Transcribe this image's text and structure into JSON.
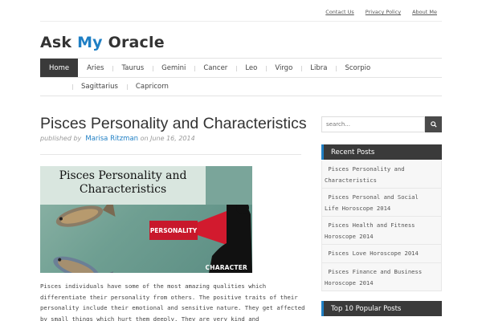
{
  "top_links": [
    "Contact Us",
    "Privacy Policy",
    "About Me"
  ],
  "logo": {
    "part1": "Ask ",
    "accent": "My",
    "part2": " Oracle"
  },
  "nav": {
    "row1": [
      "Home",
      "Aries",
      "Taurus",
      "Gemini",
      "Cancer",
      "Leo",
      "Virgo",
      "Libra",
      "Scorpio"
    ],
    "row2": [
      "Sagittarius",
      "Capricorn"
    ],
    "active": "Home"
  },
  "post": {
    "title": "Pisces Personality and Characteristics",
    "meta_prefix": "published by",
    "author": "Marisa Ritzman",
    "meta_on": "on",
    "date": "June 16, 2014",
    "image": {
      "heading_line1": "Pisces Personality and",
      "heading_line2": "Characteristics",
      "personality_label": "PERSONALITY",
      "character_label": "CHARACTER"
    },
    "body": "Pisces individuals have some of the most amazing qualities which differentiate their personality from others. The positive traits of their personality include their emotional and sensitive nature. They get affected by small things which hurt them deeply. They are very kind and"
  },
  "sidebar": {
    "search_placeholder": "search...",
    "recent_title": "Recent Posts",
    "recent_posts": [
      {
        "line1": " Pisces Personality and",
        "line2": "Characteristics"
      },
      {
        "line1": " Pisces Personal and Social",
        "line2": "Life Horoscope 2014"
      },
      {
        "line1": " Pisces Health and Fitness",
        "line2": "Horoscope 2014"
      },
      {
        "line1": " Pisces Love Horoscope 2014",
        "line2": ""
      },
      {
        "line1": " Pisces Finance and Business",
        "line2": "Horoscope 2014"
      }
    ],
    "popular_title": "Top 10 Popular Posts"
  },
  "colors": {
    "accent": "#1f7fc4",
    "nav_active": "#3a3a3a",
    "image_red": "#c8182b"
  }
}
